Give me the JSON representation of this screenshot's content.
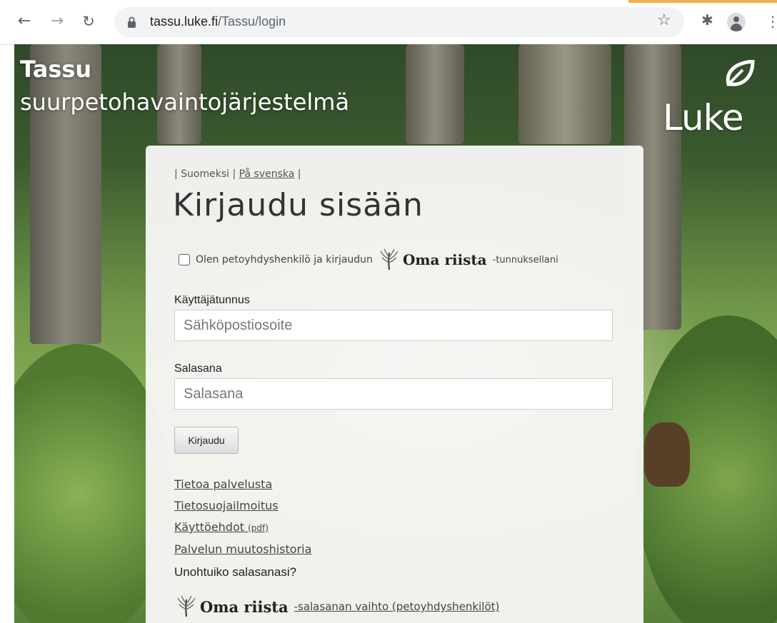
{
  "browser": {
    "url_host": "tassu.luke.fi",
    "url_path": "/Tassu/login",
    "icons": [
      "back-icon",
      "forward-icon",
      "reload-icon",
      "lock-icon",
      "star-icon",
      "puzzle-icon",
      "profile-icon",
      "kebab-icon"
    ]
  },
  "site": {
    "title_line1": "Tassu",
    "title_line2": "suurpetohavaintojärjestelmä",
    "logo_text": "Luke"
  },
  "lang": {
    "sep_left": "| ",
    "finnish": "Suomeksi",
    "sep_mid": " | ",
    "swedish": "På svenska",
    "sep_right": " |"
  },
  "login": {
    "heading": "Kirjaudu sisään",
    "checkbox_label": "Olen petoyhdyshenkilö ja kirjaudun",
    "oma_riista": "Oma riista",
    "checkbox_suffix": "-tunnuksellani",
    "username_label": "Käyttäjätunnus",
    "username_placeholder": "Sähköpostiosoite",
    "password_label": "Salasana",
    "password_placeholder": "Salasana",
    "submit": "Kirjaudu"
  },
  "links": {
    "about": "Tietoa palvelusta",
    "privacy": "Tietosuojailmoitus",
    "terms": "Käyttöehdot ",
    "terms_pdf": "(pdf)",
    "history": "Palvelun muutoshistoria"
  },
  "forgot": {
    "title": "Unohtuiko salasanasi?",
    "oma_riista": "Oma riista",
    "reset_link": "-salasanan vaihto (petoyhdyshenkilöt)"
  },
  "colors": {
    "accent_strip": "#f0b04d",
    "panel_bg": "#f6f6f4"
  }
}
